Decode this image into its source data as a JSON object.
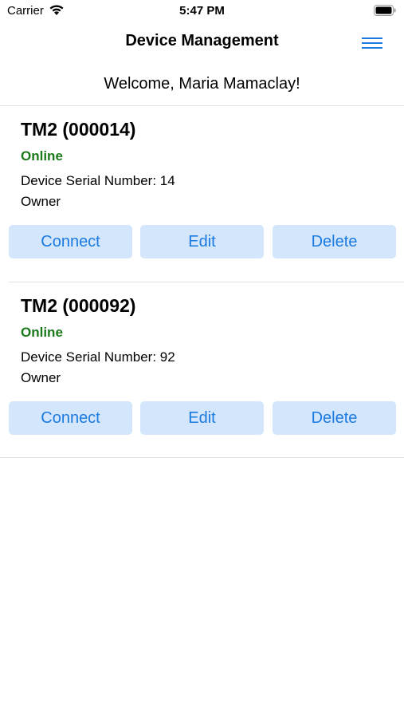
{
  "status_bar": {
    "carrier": "Carrier",
    "time": "5:47 PM",
    "wifi_icon": "wifi-icon",
    "battery_icon": "battery-icon"
  },
  "nav": {
    "title": "Device Management",
    "menu_icon": "hamburger-menu-icon",
    "accent_color": "#1a7ae0"
  },
  "welcome": "Welcome, Maria Mamaclay!",
  "devices": [
    {
      "name": "TM2 (000014)",
      "status": "Online",
      "serial": "Device Serial Number: 14",
      "role": "Owner",
      "buttons": {
        "connect": "Connect",
        "edit": "Edit",
        "delete": "Delete"
      }
    },
    {
      "name": "TM2 (000092)",
      "status": "Online",
      "serial": "Device Serial Number: 92",
      "role": "Owner",
      "buttons": {
        "connect": "Connect",
        "edit": "Edit",
        "delete": "Delete"
      }
    }
  ],
  "colors": {
    "online": "#1a7a1a",
    "button_bg": "#d4e6fb",
    "button_text": "#1a7ae0"
  }
}
